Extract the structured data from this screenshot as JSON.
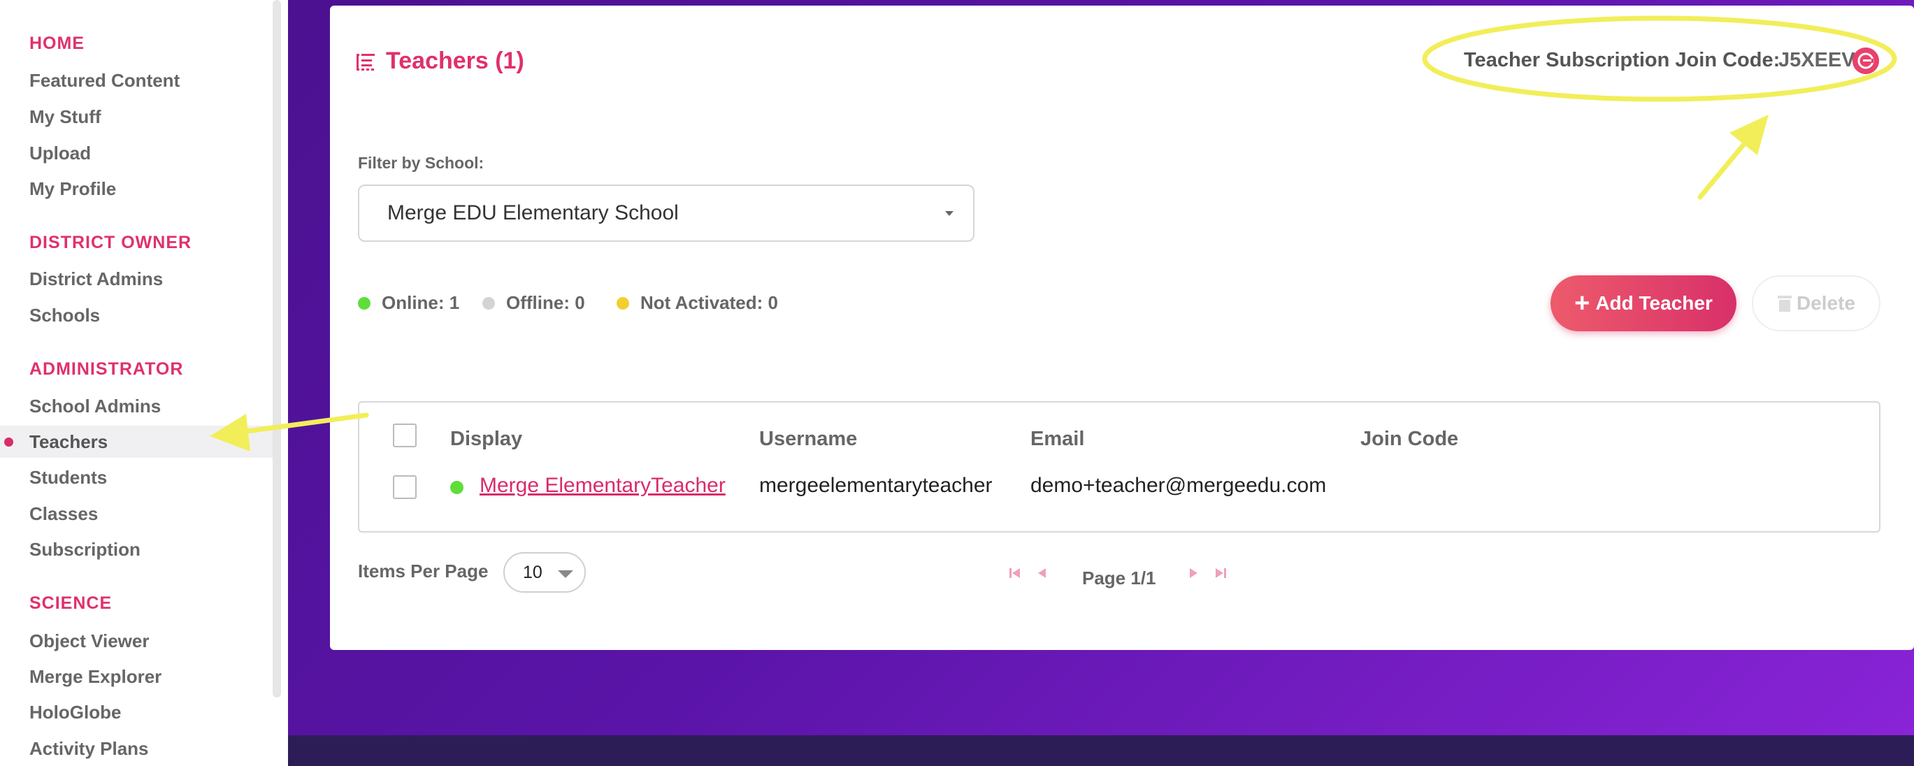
{
  "sidebar": {
    "sections": [
      {
        "heading": "HOME",
        "items": [
          "Featured Content",
          "My Stuff",
          "Upload",
          "My Profile"
        ]
      },
      {
        "heading": "DISTRICT OWNER",
        "items": [
          "District Admins",
          "Schools"
        ]
      },
      {
        "heading": "ADMINISTRATOR",
        "items": [
          "School Admins",
          "Teachers",
          "Students",
          "Classes",
          "Subscription"
        ]
      },
      {
        "heading": "SCIENCE",
        "items": [
          "Object Viewer",
          "Merge Explorer",
          "HoloGlobe",
          "Activity Plans"
        ]
      }
    ],
    "active_item": "Teachers"
  },
  "page": {
    "title": "Teachers (1)",
    "join_code_label": "Teacher Subscription Join Code:",
    "join_code_value": "J5XEEV"
  },
  "filter": {
    "label": "Filter by School:",
    "selected": "Merge EDU Elementary School"
  },
  "status": {
    "online": "Online: 1",
    "offline": "Offline: 0",
    "not_activated": "Not Activated: 0",
    "colors": {
      "online": "#5fdd3a",
      "offline": "#d4d4d4",
      "not_activated": "#f2cf2e"
    }
  },
  "actions": {
    "add": "Add Teacher",
    "delete": "Delete"
  },
  "table": {
    "headers": [
      "Display",
      "Username",
      "Email",
      "Join Code"
    ],
    "rows": [
      {
        "display": "Merge ElementaryTeacher",
        "username": "mergeelementaryteacher",
        "email": "demo+teacher@mergeedu.com",
        "join_code": "",
        "status": "online"
      }
    ]
  },
  "pagination": {
    "items_per_page_label": "Items Per Page",
    "items_per_page": "10",
    "page_text": "Page 1/1"
  },
  "colors": {
    "accent": "#e0306e",
    "annotation": "#f2ee5a",
    "background_purple": "#5a14a8"
  }
}
